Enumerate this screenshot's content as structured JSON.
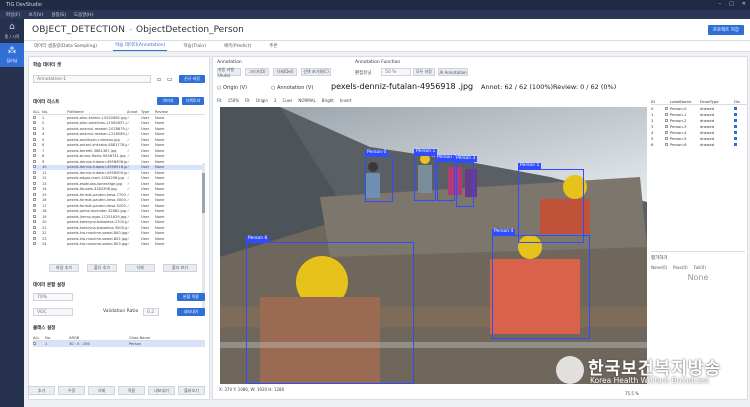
{
  "app": {
    "title": "TIG DevStudio",
    "controls": [
      "–",
      "□",
      "✕"
    ]
  },
  "menu": [
    "파일(F)",
    "보기(V)",
    "설정(S)",
    "도움말(H)"
  ],
  "nav": [
    {
      "label": "홈 / 시작",
      "icon": "home-icon"
    },
    {
      "label": "딥러닝",
      "icon": "network-icon"
    }
  ],
  "header": {
    "project": "OBJECT_DETECTION",
    "sep": "-",
    "name": "ObjectDetection_Person",
    "button": "프로젝트 저장"
  },
  "tabs": [
    "데이터 샘플링(Data Sampling)",
    "학습 데이터(Annotation)",
    "학습(Train)",
    "예측(Predict)",
    "추론"
  ],
  "left": {
    "dataset_title": "학습 데이터 셋",
    "dataset_value": "Annotation-1",
    "dataset_btn": "신규 저장",
    "list_title": "데이터 리스트",
    "list_btn1": "이미지",
    "list_btn2": "디렉토리",
    "cols": {
      "all": "ALL",
      "no": "No.",
      "file": "FileName",
      "annot": "Annot",
      "type": "Type",
      "review": "Review"
    },
    "rows": [
      {
        "no": "1",
        "file": "pexels-alex-kalinin-10202862.jpg",
        "type": "User",
        "review": "None"
      },
      {
        "no": "2",
        "file": "pexels-alex-amelines-11500637.jpg",
        "type": "User",
        "review": "None"
      },
      {
        "no": "3",
        "file": "pexels-anamul-rezwan-1078879.jpg",
        "type": "User",
        "review": "None"
      },
      {
        "no": "4",
        "file": "pexels-anamul-rezwan-1216589.jpg",
        "type": "User",
        "review": "None"
      },
      {
        "no": "5",
        "file": "pexels-andreyan-ruimeau.jpg",
        "type": "User",
        "review": "None"
      },
      {
        "no": "6",
        "file": "pexels-antoni-shkraba-4881778.jpg",
        "type": "User",
        "review": "None"
      },
      {
        "no": "7",
        "file": "pexels-bertelli-3681367.jpg",
        "type": "User",
        "review": "None"
      },
      {
        "no": "8",
        "file": "pexels-bruno-flavio-9436741.jpg",
        "type": "User",
        "review": "None"
      },
      {
        "no": "9",
        "file": "pexels-denniz-futalan-4956908.jpg",
        "type": "User",
        "review": "None"
      },
      {
        "no": "10",
        "file": "pexels-denniz-futalan-4956918.jpg",
        "type": "User",
        "review": "None",
        "sel": true
      },
      {
        "no": "11",
        "file": "pexels-denniz-futalan-4956909.jpg",
        "type": "User",
        "review": "None"
      },
      {
        "no": "12",
        "file": "pexels-edgar-mart-1005296.jpg",
        "type": "User",
        "review": "None"
      },
      {
        "no": "13",
        "file": "pexels-esabulas-kaneshige.jpg",
        "type": "User",
        "review": "None"
      },
      {
        "no": "14",
        "file": "pexels-fauxels-3184398.jpg",
        "type": "User",
        "review": "None"
      },
      {
        "no": "15",
        "file": "pexels-format-pauten-kesa-7700.jpg",
        "type": "User",
        "review": "None"
      },
      {
        "no": "16",
        "file": "pexels-format-pauten-kesa-5000.jpg",
        "type": "User",
        "review": "None"
      },
      {
        "no": "17",
        "file": "pexels-format-pauten-kesa-5200.jpg",
        "type": "User",
        "review": "None"
      },
      {
        "no": "18",
        "file": "pexels-jamie-lavender-32862.jpg",
        "type": "User",
        "review": "None"
      },
      {
        "no": "19",
        "file": "pexels-jimmy-egor-11251629.jpg",
        "type": "User",
        "review": "None"
      },
      {
        "no": "20",
        "file": "pexels-kateryna-babaieva-2700.jpg",
        "type": "User",
        "review": "None"
      },
      {
        "no": "21",
        "file": "pexels-kateryna-babaieva-3000.jpg",
        "type": "User",
        "review": "None"
      },
      {
        "no": "22",
        "file": "pexels-kia-maxime-sowei-800.jpg",
        "type": "User",
        "review": "None"
      },
      {
        "no": "23",
        "file": "pexels-kia-maxime-sowei-802.jpg",
        "type": "User",
        "review": "None"
      },
      {
        "no": "24",
        "file": "pexels-kia-maxime-sowei-803.jpg",
        "type": "User",
        "review": "None"
      }
    ],
    "list_btns": [
      "파일 추가",
      "폴더 추가",
      "삭제",
      "폴더 보기"
    ],
    "split_title": "데이터 분할 설정",
    "split_a": "70%",
    "split_b": "VOC",
    "val_label": "Validation Ratio",
    "val_value": "0.2",
    "split_btn1": "분할 적용",
    "split_btn2": "내보내기",
    "class_title": "클래스 설정",
    "class_cols": {
      "all": "ALL",
      "no": "No.",
      "argb": "ARGB",
      "name": "Class Name"
    },
    "class_row": {
      "no": "1",
      "argb": "30 : 0 : 256",
      "name": "Person"
    },
    "bottom": [
      "추가",
      "수정",
      "삭제",
      "적용",
      "내보내기",
      "불러오기"
    ]
  },
  "right": {
    "annotation_label": "Annotation",
    "anno_btns": [
      "자동 라벨(Auto)",
      "그리기(D)",
      "삭제(Del)",
      "선택 초기화(C)"
    ],
    "func_label": "Annotation Function",
    "func_field": "편집유닛",
    "func_value": "50 %",
    "func_btn1": "모두 저장",
    "func_btn2": "AI Annotation",
    "origin": "Origin (V)",
    "annotation": "Annotation (V)",
    "filename": "pexels-denniz-futalan-4956918 .jpg",
    "annot_label": "Annot: 62 / 62 (100%)",
    "review_label": "Review: 0 / 62 (0%)",
    "toolbar": [
      "Fit",
      "150%",
      "Fit",
      "Origin",
      "2",
      "Cues",
      "NORMAL",
      "Bright",
      "Invert"
    ],
    "boxes": [
      "Person 0",
      "Person 1",
      "Person 2",
      "Person 3",
      "Person 4",
      "Person 5",
      "Person 6"
    ],
    "table_cols": {
      "id": "ID",
      "name": "LabelName",
      "type": "DrawType",
      "d": "Dis"
    },
    "table": [
      {
        "id": "0",
        "name": "Person-0",
        "type": "drawed"
      },
      {
        "id": "1",
        "name": "Person-1",
        "type": "drawed"
      },
      {
        "id": "2",
        "name": "Person-2",
        "type": "drawed"
      },
      {
        "id": "3",
        "name": "Person-3",
        "type": "drawed"
      },
      {
        "id": "4",
        "name": "Person-4",
        "type": "drawed"
      },
      {
        "id": "5",
        "name": "Person-5",
        "type": "drawed"
      },
      {
        "id": "6",
        "name": "Person-6",
        "type": "drawed"
      }
    ],
    "review_title": "평가하기",
    "review_opts": [
      "None(0)",
      "Pass(0)",
      "Fail(0)"
    ],
    "review_value": "None",
    "status": "X: 370 Y: 1086, W: 1920 H: 1280",
    "zoom": "75.5 %"
  },
  "watermark": {
    "ko": "한국보건복지방송",
    "en": "Korea Health Welfare Broadcast"
  },
  "colors": {
    "accent": "#2f6fd6",
    "bbox": "#2f4cff",
    "nav": "#26314d"
  }
}
